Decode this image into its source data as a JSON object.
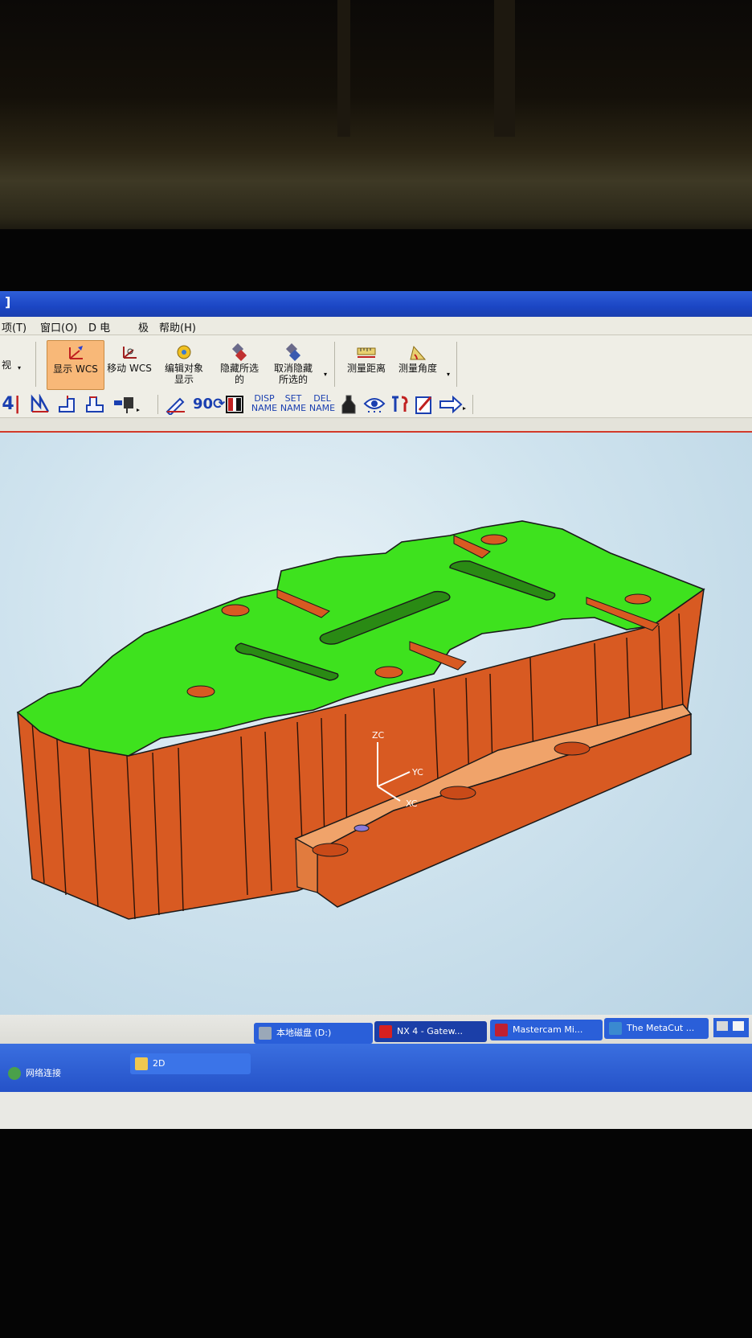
{
  "window": {
    "title": "]"
  },
  "menu": {
    "items": [
      "项(T)",
      "窗口(O)",
      "D 电",
      "极",
      "帮助(H)"
    ]
  },
  "toolbar1": {
    "left_label": "视",
    "buttons": [
      {
        "label": "显示 WCS",
        "icon": "wcs-display-icon",
        "active": true
      },
      {
        "label": "移动 WCS",
        "icon": "wcs-move-icon",
        "active": false
      },
      {
        "label": "编辑对象显示",
        "icon": "edit-object-display-icon",
        "active": false
      },
      {
        "label": "隐藏所选的",
        "icon": "hide-selected-icon",
        "active": false
      },
      {
        "label": "取消隐藏所选的",
        "icon": "unhide-selected-icon",
        "active": false
      },
      {
        "label": "测量距离",
        "icon": "measure-distance-icon",
        "active": false
      },
      {
        "label": "测量角度",
        "icon": "measure-angle-icon",
        "active": false
      }
    ]
  },
  "toolbar2": {
    "text_buttons": [
      {
        "top": "DISP",
        "bottom": "NAME"
      },
      {
        "top": "SET",
        "bottom": "NAME"
      },
      {
        "top": "DEL",
        "bottom": "NAME"
      }
    ],
    "rotate_label": "90"
  },
  "viewport": {
    "axes": {
      "z": "ZC",
      "y": "YC",
      "x": "XC"
    },
    "colors": {
      "top_face": "#3ee21e",
      "side_face": "#d85a22",
      "flange": "#f0a36a",
      "outline": "#1a1a1a"
    }
  },
  "taskbar": {
    "row1": [
      "本地磁盘 (D:)",
      "NX 4 - Gatew...",
      "Mastercam Mi...",
      "The MetaCut ..."
    ],
    "row2": [
      "网络连接",
      "2D"
    ]
  },
  "colors": {
    "titlebar": "#1b46c4",
    "active_button": "#f8b878",
    "taskbar": "#2a5fd9"
  }
}
